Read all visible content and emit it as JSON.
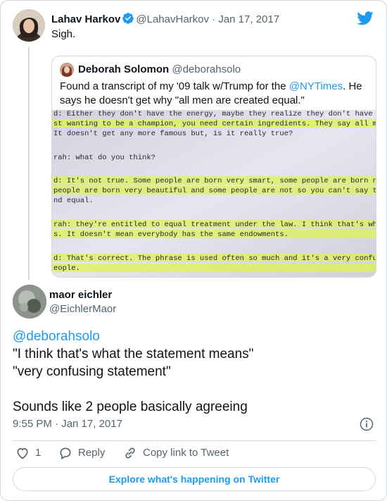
{
  "parent_tweet": {
    "name": "Lahav Harkov",
    "handle": "@LahavHarkov",
    "date": "· Jan 17, 2017",
    "text": "Sigh."
  },
  "quoted_tweet": {
    "name": "Deborah Solomon",
    "handle": "@deborahsolo",
    "text_before": "Found a transcript of my '09 talk w/Trump for the ",
    "link": "@NYTimes",
    "text_after": ". He says he doesn't get why \"all men are created equal.\"",
    "photo_lines": [
      "d:  Either they don't have the energy, maybe they realize they don't have the talent.",
      "st wanting to be a champion, you need certain ingredients.  They say all men are cre",
      "  It doesn't get any more famous but, is it really true?",
      "rah:  what do you think?",
      "d: It's not true.  Some people are born very smart, some people are born not so sm",
      " people are born very beautiful and some people are not so you can't say they're al",
      "nd equal.",
      "rah:  they're entitled to equal treatment under the law.  I think that's what the staten",
      "s.  It doesn't mean everybody has the same endowments.",
      "d:  That's correct.  The phrase is used often so much and it's a very confusing ph",
      "eople."
    ]
  },
  "main_tweet": {
    "name": "maor eichler",
    "handle": "@EichlerMaor",
    "mention": "@deborahsolo",
    "line1": "\"I think that's what the statement means\"",
    "line2": "\"very confusing statement\"",
    "line3": "Sounds like 2 people basically agreeing",
    "timestamp": "9:55 PM · Jan 17, 2017"
  },
  "actions": {
    "like_count": "1",
    "reply_label": "Reply",
    "copy_label": "Copy link to Tweet"
  },
  "explore_label": "Explore what's happening on Twitter",
  "colors": {
    "accent": "#1d9bf0",
    "secondary_text": "#536471",
    "border": "#cfd9de",
    "highlighter": "#dff255"
  },
  "icons": [
    "twitter-bird-icon",
    "verified-badge-icon",
    "info-icon",
    "heart-icon",
    "reply-bubble-icon",
    "link-icon"
  ]
}
